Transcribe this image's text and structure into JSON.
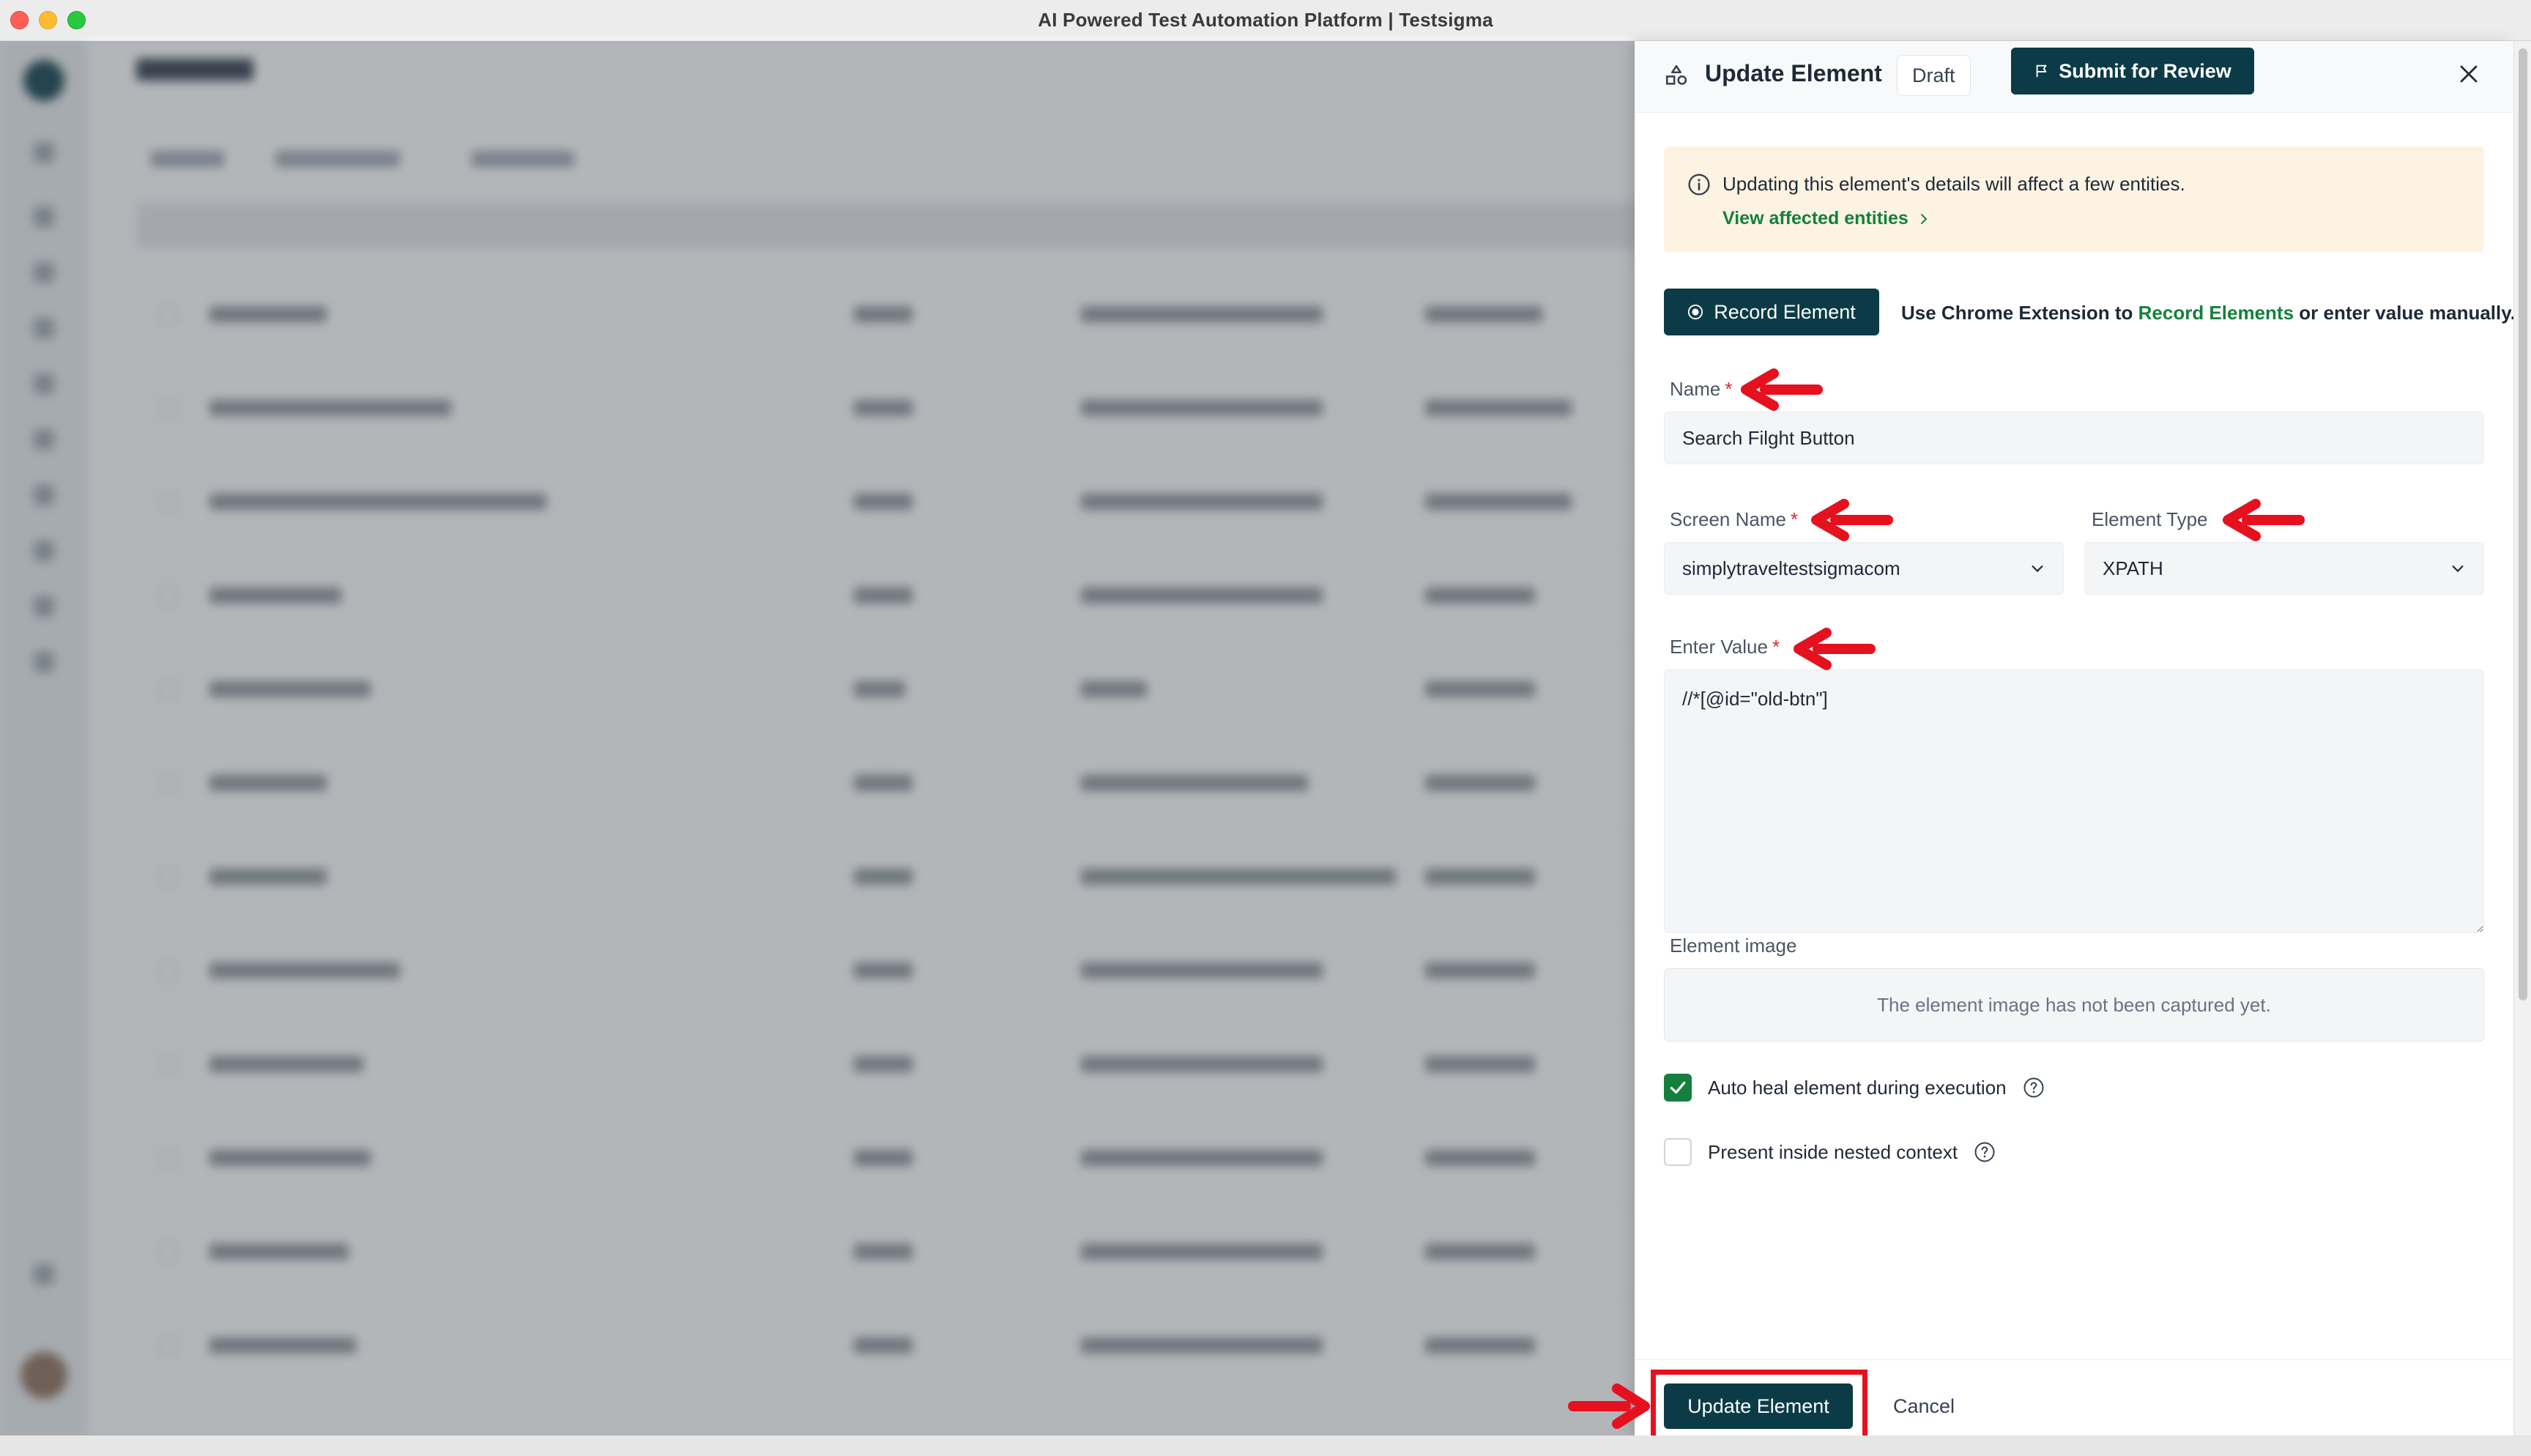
{
  "window": {
    "title": "AI Powered Test Automation Platform | Testsigma"
  },
  "drawer": {
    "title": "Update Element",
    "status_badge": "Draft",
    "submit_label": "Submit for Review",
    "notice": {
      "text": "Updating this element's details will affect a few entities.",
      "link": "View affected entities"
    },
    "record": {
      "button_label": "Record Element",
      "help_prefix": "Use Chrome Extension to ",
      "help_link": "Record Elements",
      "help_suffix": " or enter value manually."
    },
    "name_field": {
      "label": "Name",
      "required_mark": "*",
      "value": "Search Filght Button"
    },
    "screen_name": {
      "label": "Screen Name",
      "required_mark": "*",
      "value": "simplytraveltestsigmacom"
    },
    "element_type": {
      "label": "Element Type",
      "value": "XPATH"
    },
    "enter_value": {
      "label": "Enter Value",
      "required_mark": "*",
      "value": "//*[@id=\"old-btn\"]"
    },
    "element_image": {
      "label": "Element image",
      "empty_text": "The element image has not been captured yet."
    },
    "auto_heal": {
      "label": "Auto heal element during execution",
      "checked": true
    },
    "nested_context": {
      "label": "Present inside nested context",
      "checked": false
    },
    "footer": {
      "update_label": "Update Element",
      "cancel_label": "Cancel"
    }
  },
  "colors": {
    "primary_dark": "#0b3b46",
    "success_green": "#15803d",
    "required_red": "#dc2626",
    "annotation_red": "#e5111e",
    "notice_bg": "#fdf3e2"
  },
  "icons": {
    "header": "elements-shapes-icon",
    "submit": "flag-icon",
    "close": "close-icon",
    "notice": "info-icon",
    "notice_link": "chevron-right-icon",
    "record": "record-dot-icon",
    "select": "chevron-down-icon",
    "help": "help-circle-icon",
    "checkmark": "checkmark-icon",
    "annotation": "red-arrow-icon"
  }
}
